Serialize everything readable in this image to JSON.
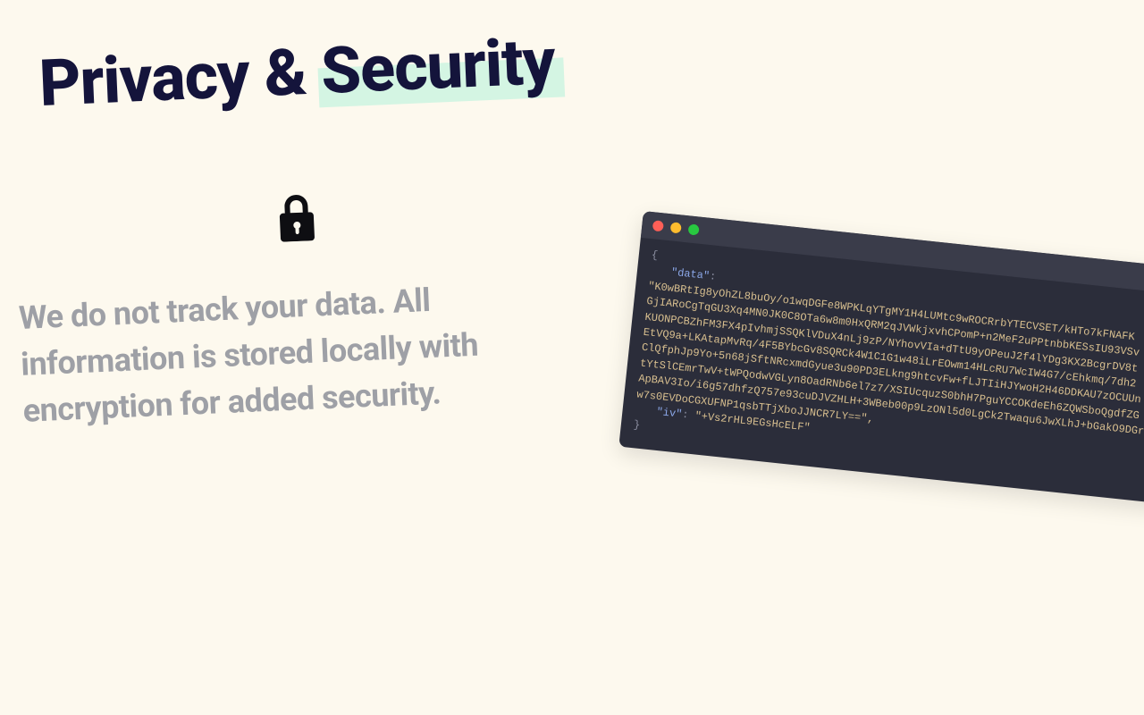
{
  "heading": {
    "prefix": "Privacy & ",
    "highlight": "Security"
  },
  "description": "We do not track your data. All information is stored locally with encryption for added security.",
  "terminal": {
    "open": "{",
    "key_data": "\"data\"",
    "colon": ":",
    "data_line1": "\"K0wBRtIg8yOhZL8buOy/o1wqDGFe8WPKLqYTgMY1H4LUMtc9wROCRrbYTECVSET/kHTo7kFNAFK",
    "data_line2": "GjIARoCgTqGU3Xq4MN0JK0C8OTa6w8m0HxQRM2qJVWkjxvhCPomP+n2MeF2uPPtnbbKESsIU93VSv",
    "data_line3": "KUONPCBZhFM3FX4pIvhmjSSQKlVDuX4nLj9zP/NYhovVIa+dTtU9yOPeuJ2f4lYDg3KX2BcgrDV8t",
    "data_line4": "EtVQ9a+LKAtapMvRq/4F5BYbcGv8SQRCk4W1C1G1w48iLrEOwm14HLcRU7WcIW4G7/cEhkmq/7dh2",
    "data_line5": "ClQfphJp9Yo+5n68jSftNRcxmdGyue3u90PD3ELkng9htcvFw+fLJTIiHJYwoH2H46DDKAU7zOCUUn",
    "data_line6": "tYtSlCEmrTwV+tWPQodwVGLyn8OadRNb6el7z7/XSIUcquzS0bhH7PguYCCOKdeEh6ZQWSboQgdfZG",
    "data_line7": "ApBAV3Io/i6g57dhfzQ757e93cuDJVZHLH+3WBeb00p9LzONl5d0LgCk2Twaqu6JwXLhJ+bGakO9DGr",
    "data_line8": "w7s0EVDoCGXUFNP1qsbTTjXboJJNCR7LY==\",",
    "key_iv": "\"iv\"",
    "iv_value": "\"+Vs2rHL9EGsHcELF\"",
    "close": "}"
  }
}
